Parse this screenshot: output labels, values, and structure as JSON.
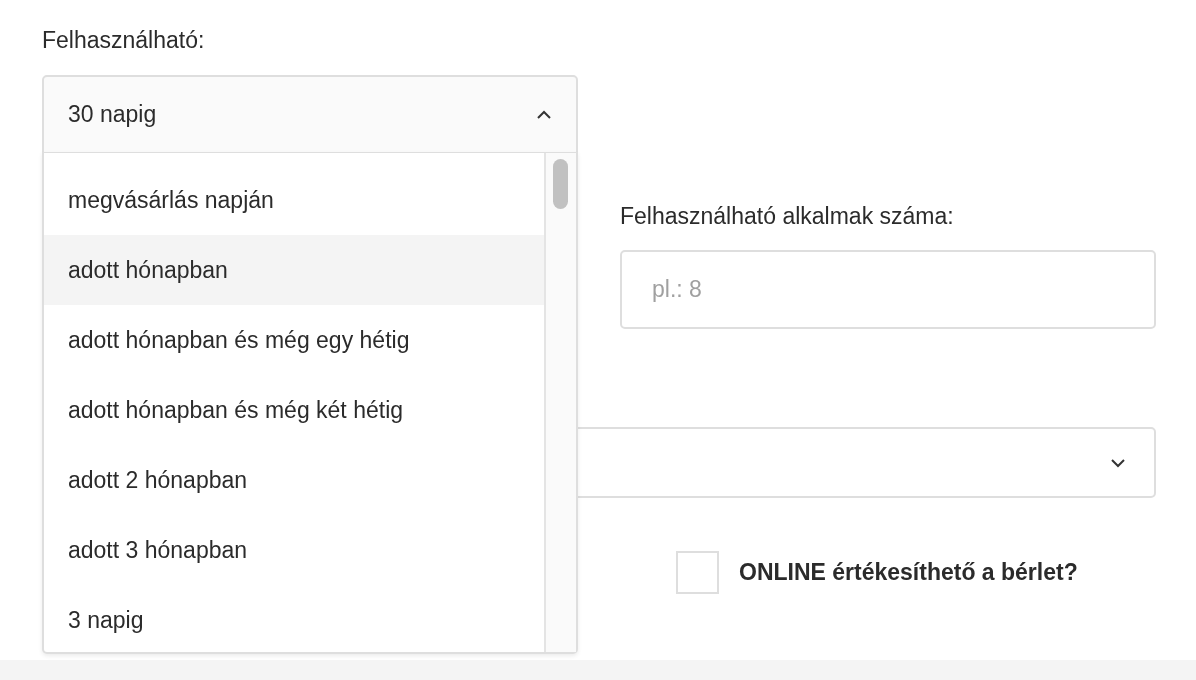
{
  "validity": {
    "label": "Felhasználható:",
    "value": "30 napig",
    "expanded": true,
    "options": [
      {
        "label": "megvásárlás napján",
        "highlighted": false
      },
      {
        "label": "adott hónapban",
        "highlighted": true
      },
      {
        "label": "adott hónapban és még egy hétig",
        "highlighted": false
      },
      {
        "label": "adott hónapban és még két hétig",
        "highlighted": false
      },
      {
        "label": "adott 2 hónapban",
        "highlighted": false
      },
      {
        "label": "adott 3 hónapban",
        "highlighted": false
      },
      {
        "label": "3 napig",
        "highlighted": false
      }
    ]
  },
  "occasions": {
    "label": "Felhasználható alkalmak száma:",
    "placeholder": "pl.: 8"
  },
  "online": {
    "label": "ONLINE értékesíthető a bérlet?",
    "checked": false
  }
}
